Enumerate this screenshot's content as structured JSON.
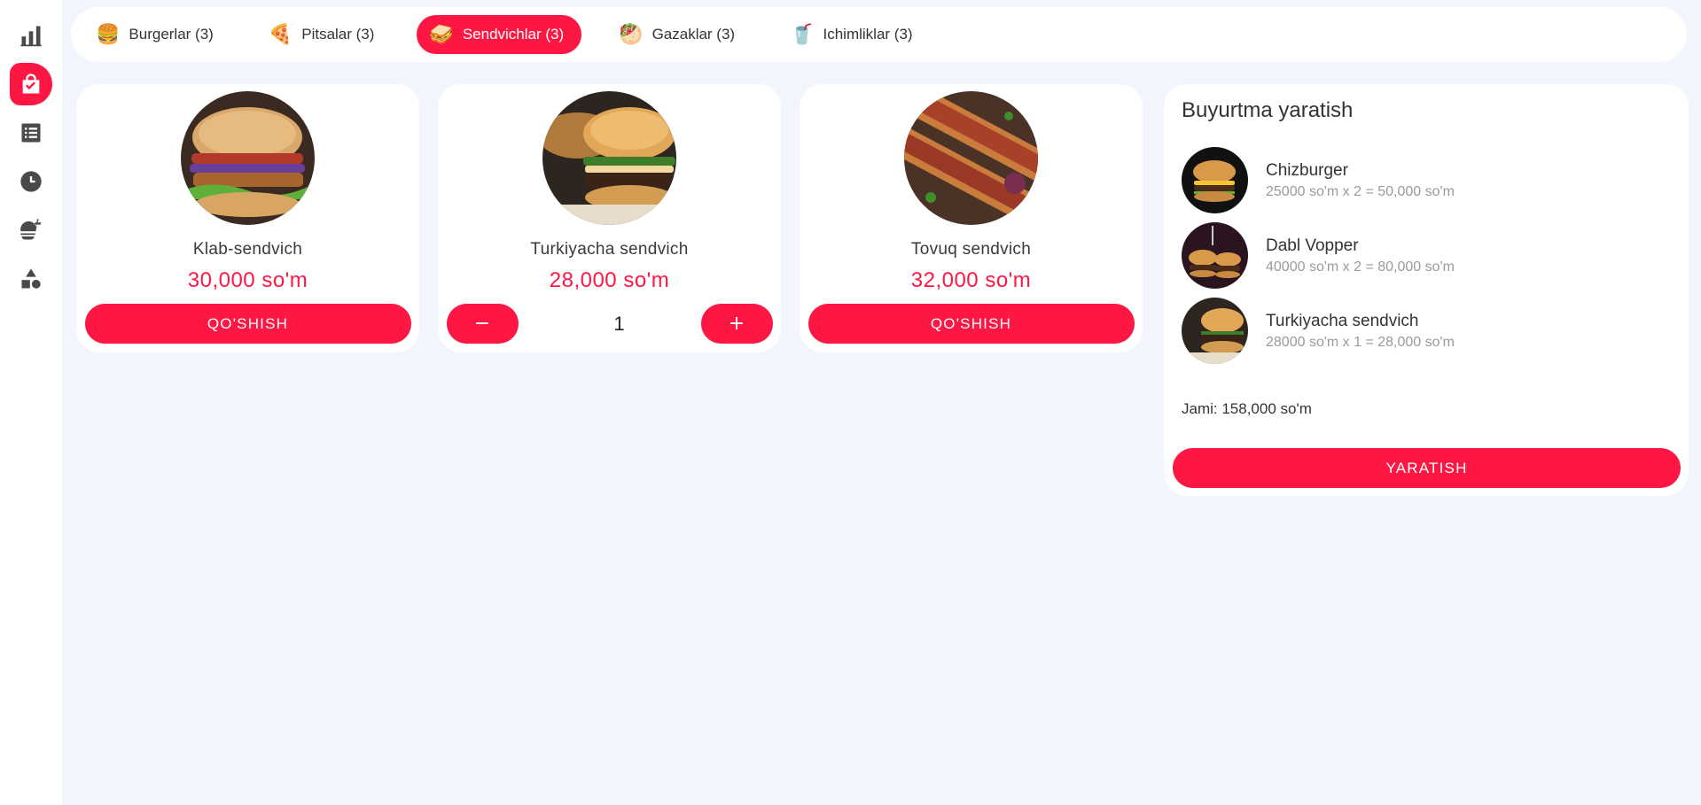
{
  "sidebar": {
    "items": [
      {
        "icon": "bar-chart-icon",
        "active": false
      },
      {
        "icon": "shopping-bag-icon",
        "active": true
      },
      {
        "icon": "list-icon",
        "active": false
      },
      {
        "icon": "clock-icon",
        "active": false
      },
      {
        "icon": "fastfood-icon",
        "active": false
      },
      {
        "icon": "shapes-icon",
        "active": false
      }
    ]
  },
  "tabs": [
    {
      "label": "Burgerlar (3)",
      "icon": "🍔",
      "active": false
    },
    {
      "label": "Pitsalar (3)",
      "icon": "🍕",
      "active": false
    },
    {
      "label": "Sendvichlar (3)",
      "icon": "🥪",
      "active": true
    },
    {
      "label": "Gazaklar (3)",
      "icon": "🥙",
      "active": false
    },
    {
      "label": "Ichimliklar (3)",
      "icon": "🥤",
      "active": false
    }
  ],
  "products": [
    {
      "name": "Klab-sendvich",
      "price": "30,000 so'm",
      "button": "QO'SHISH"
    },
    {
      "name": "Turkiyacha sendvich",
      "price": "28,000 so'm",
      "minus": "−",
      "qty": "1",
      "plus": "+"
    },
    {
      "name": "Tovuq sendvich",
      "price": "32,000 so'm",
      "button": "QO'SHISH"
    }
  ],
  "order": {
    "title": "Buyurtma yaratish",
    "items": [
      {
        "name": "Chizburger",
        "detail": "25000 so'm x 2 = 50,000 so'm"
      },
      {
        "name": "Dabl Vopper",
        "detail": "40000 so'm x 2 = 80,000 so'm"
      },
      {
        "name": "Turkiyacha sendvich",
        "detail": "28000 so'm x 1 = 28,000 so'm"
      }
    ],
    "total": "Jami: 158,000 so'm",
    "create_button": "YARATISH"
  },
  "colors": {
    "accent": "#ff1744",
    "background": "#f2f5fd"
  }
}
